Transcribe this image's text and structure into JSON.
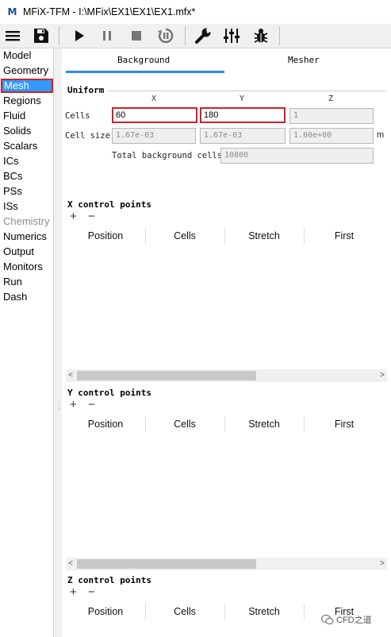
{
  "window": {
    "title": "MFiX-TFM - I:\\MFix\\EX1\\EX1\\EX1.mfx*",
    "app_icon_text": "M"
  },
  "toolbar": {
    "items": [
      {
        "name": "menu-icon",
        "label": "Menu"
      },
      {
        "name": "save-icon",
        "label": "Save"
      },
      {
        "name": "play-icon",
        "label": "Run"
      },
      {
        "name": "pause-icon",
        "label": "Pause"
      },
      {
        "name": "stop-icon",
        "label": "Stop"
      },
      {
        "name": "reset-icon",
        "label": "Reset"
      },
      {
        "name": "wrench-icon",
        "label": "Build"
      },
      {
        "name": "sliders-icon",
        "label": "Settings"
      },
      {
        "name": "bug-icon",
        "label": "Debug"
      }
    ]
  },
  "sidebar": {
    "items": [
      {
        "label": "Model",
        "state": "normal"
      },
      {
        "label": "Geometry",
        "state": "normal"
      },
      {
        "label": "Mesh",
        "state": "selected"
      },
      {
        "label": "Regions",
        "state": "normal"
      },
      {
        "label": "Fluid",
        "state": "normal"
      },
      {
        "label": "Solids",
        "state": "normal"
      },
      {
        "label": "Scalars",
        "state": "normal"
      },
      {
        "label": "ICs",
        "state": "normal"
      },
      {
        "label": "BCs",
        "state": "normal"
      },
      {
        "label": "PSs",
        "state": "normal"
      },
      {
        "label": "ISs",
        "state": "normal"
      },
      {
        "label": "Chemistry",
        "state": "disabled"
      },
      {
        "label": "Numerics",
        "state": "normal"
      },
      {
        "label": "Output",
        "state": "normal"
      },
      {
        "label": "Monitors",
        "state": "normal"
      },
      {
        "label": "Run",
        "state": "normal"
      },
      {
        "label": "Dash",
        "state": "normal"
      }
    ]
  },
  "tabs": {
    "background": "Background",
    "mesher": "Mesher"
  },
  "uniform": {
    "title": "Uniform",
    "axes": {
      "x": "X",
      "y": "Y",
      "z": "Z"
    },
    "cells_label": "Cells",
    "cells": {
      "x": "60",
      "y": "180",
      "z": "1"
    },
    "cell_size_label": "Cell size",
    "cell_size": {
      "x": "1.67e-03",
      "y": "1.67e-03",
      "z": "1.00e+00"
    },
    "cell_size_unit": "m",
    "total_label": "Total background cells",
    "total_value": "10800"
  },
  "control_points": {
    "x_title": "X control points",
    "y_title": "Y control points",
    "z_title": "Z control points",
    "add": "+",
    "remove": "−",
    "columns": [
      "Position",
      "Cells",
      "Stretch",
      "First"
    ]
  },
  "scroll_arrows": {
    "left": "<",
    "right": ">"
  },
  "watermark": {
    "text": "CFD之道"
  },
  "colors": {
    "selection": "#3399ff",
    "highlight_border": "#d0202a",
    "tab_underline": "#2f8be0"
  }
}
